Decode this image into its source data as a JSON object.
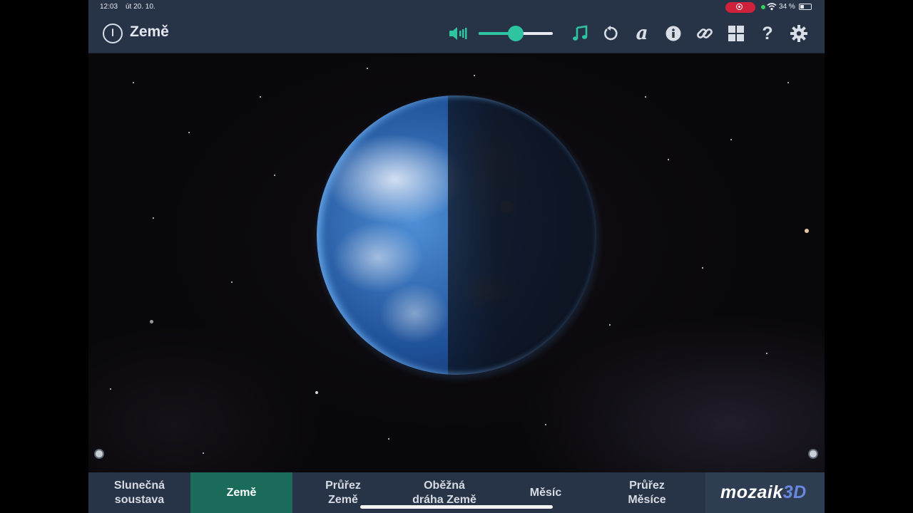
{
  "status_bar": {
    "time": "12:03",
    "date": "út 20. 10.",
    "battery": "34 %",
    "battery_level": 0.34
  },
  "header": {
    "title": "Země"
  },
  "volume": {
    "level": 0.5
  },
  "colors": {
    "accent": "#2ec4a0",
    "bar": "#273447",
    "active_tab": "#1b6b5a"
  },
  "icons": {
    "power": "power-icon",
    "speaker": "speaker-icon",
    "music": "music-note-icon",
    "reset": "rotate-icon",
    "label": "letter-a-icon",
    "info": "info-icon",
    "link": "link-icon",
    "grid": "grid-icon",
    "help": "question-icon",
    "settings": "gear-icon"
  },
  "tabs": [
    {
      "line1": "Slunečná",
      "line2": "soustava"
    },
    {
      "line1": "Země",
      "line2": ""
    },
    {
      "line1": "Průřez",
      "line2": "Země"
    },
    {
      "line1": "Oběžná",
      "line2": "dráha Země"
    },
    {
      "line1": "Měsíc",
      "line2": ""
    },
    {
      "line1": "Průřez",
      "line2": "Měsíce"
    }
  ],
  "active_tab": "Země",
  "brand": {
    "name": "mozaik",
    "suffix": "3D"
  }
}
